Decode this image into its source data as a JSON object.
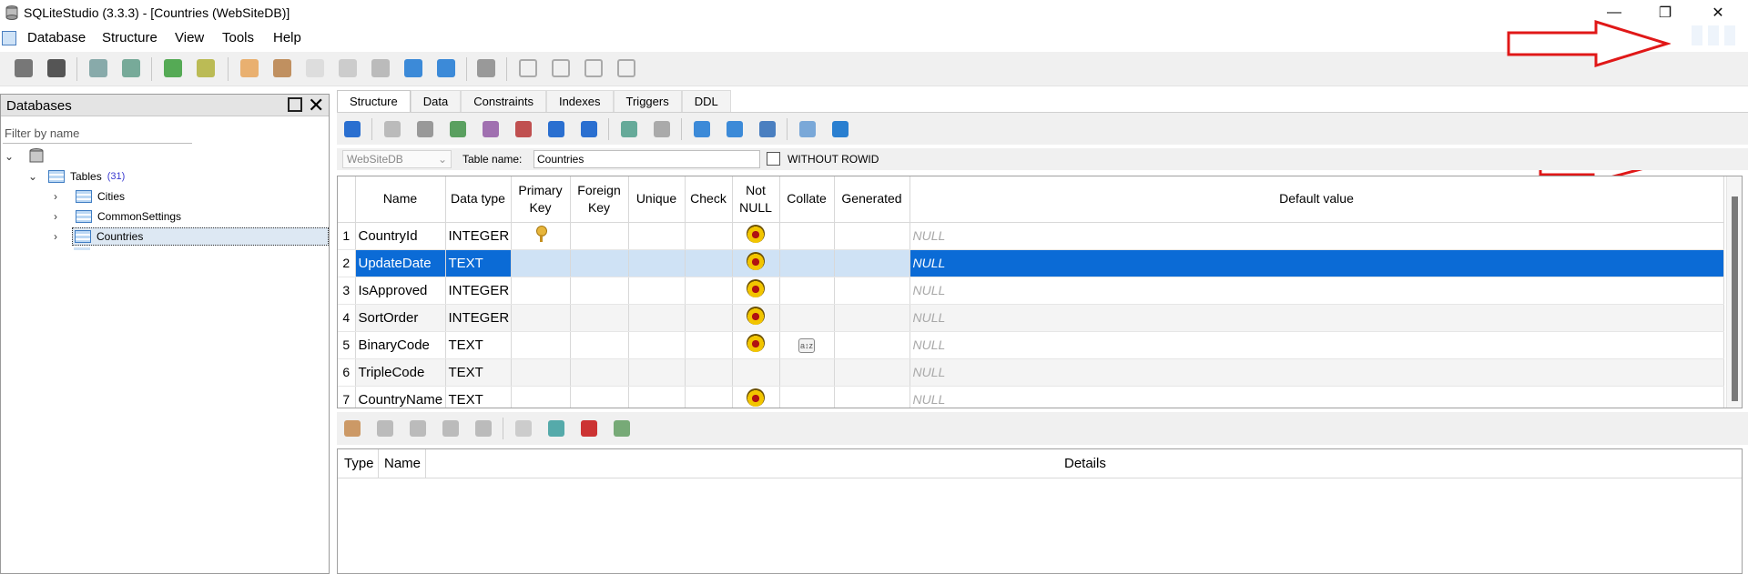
{
  "window": {
    "title": "SQLiteStudio (3.3.3) - [Countries (WebSiteDB)]",
    "minimize": "—",
    "restore": "❐",
    "close": "✕"
  },
  "menu": [
    "Database",
    "Structure",
    "View",
    "Tools",
    "Help"
  ],
  "databases_panel": {
    "title": "Databases",
    "filter_placeholder": "Filter by name",
    "tables_label": "Tables",
    "tables_count": "(31)",
    "items": [
      "Cities",
      "CommonSettings",
      "Countries"
    ]
  },
  "tabs": [
    "Structure",
    "Data",
    "Constraints",
    "Indexes",
    "Triggers",
    "DDL"
  ],
  "props": {
    "database": "WebSiteDB",
    "table_name_label": "Table name:",
    "table_name": "Countries",
    "without_rowid_label": "WITHOUT ROWID"
  },
  "columns_grid": {
    "headers": [
      "Name",
      "Data type",
      "Primary\nKey",
      "Foreign\nKey",
      "Unique",
      "Check",
      "Not\nNULL",
      "Collate",
      "Generated",
      "Default value"
    ],
    "rows": [
      {
        "n": "1",
        "name": "CountryId",
        "type": "INTEGER",
        "pk": true,
        "nn": true,
        "collate": false,
        "default": "NULL"
      },
      {
        "n": "2",
        "name": "UpdateDate",
        "type": "TEXT",
        "pk": false,
        "nn": true,
        "collate": false,
        "default": "NULL"
      },
      {
        "n": "3",
        "name": "IsApproved",
        "type": "INTEGER",
        "pk": false,
        "nn": true,
        "collate": false,
        "default": "NULL"
      },
      {
        "n": "4",
        "name": "SortOrder",
        "type": "INTEGER",
        "pk": false,
        "nn": true,
        "collate": false,
        "default": "NULL"
      },
      {
        "n": "5",
        "name": "BinaryCode",
        "type": "TEXT",
        "pk": false,
        "nn": true,
        "collate": true,
        "default": "NULL"
      },
      {
        "n": "6",
        "name": "TripleCode",
        "type": "TEXT",
        "pk": false,
        "nn": false,
        "collate": false,
        "default": "NULL"
      },
      {
        "n": "7",
        "name": "CountryName",
        "type": "TEXT",
        "pk": false,
        "nn": true,
        "collate": false,
        "default": "NULL"
      }
    ],
    "selected_row": 2
  },
  "constraints_grid": {
    "headers": [
      "Type",
      "Name",
      "Details"
    ]
  },
  "colors": {
    "selection": "#0b6bd6",
    "selection_light": "#cfe2f5",
    "annotation_arrow": "#e01818"
  }
}
